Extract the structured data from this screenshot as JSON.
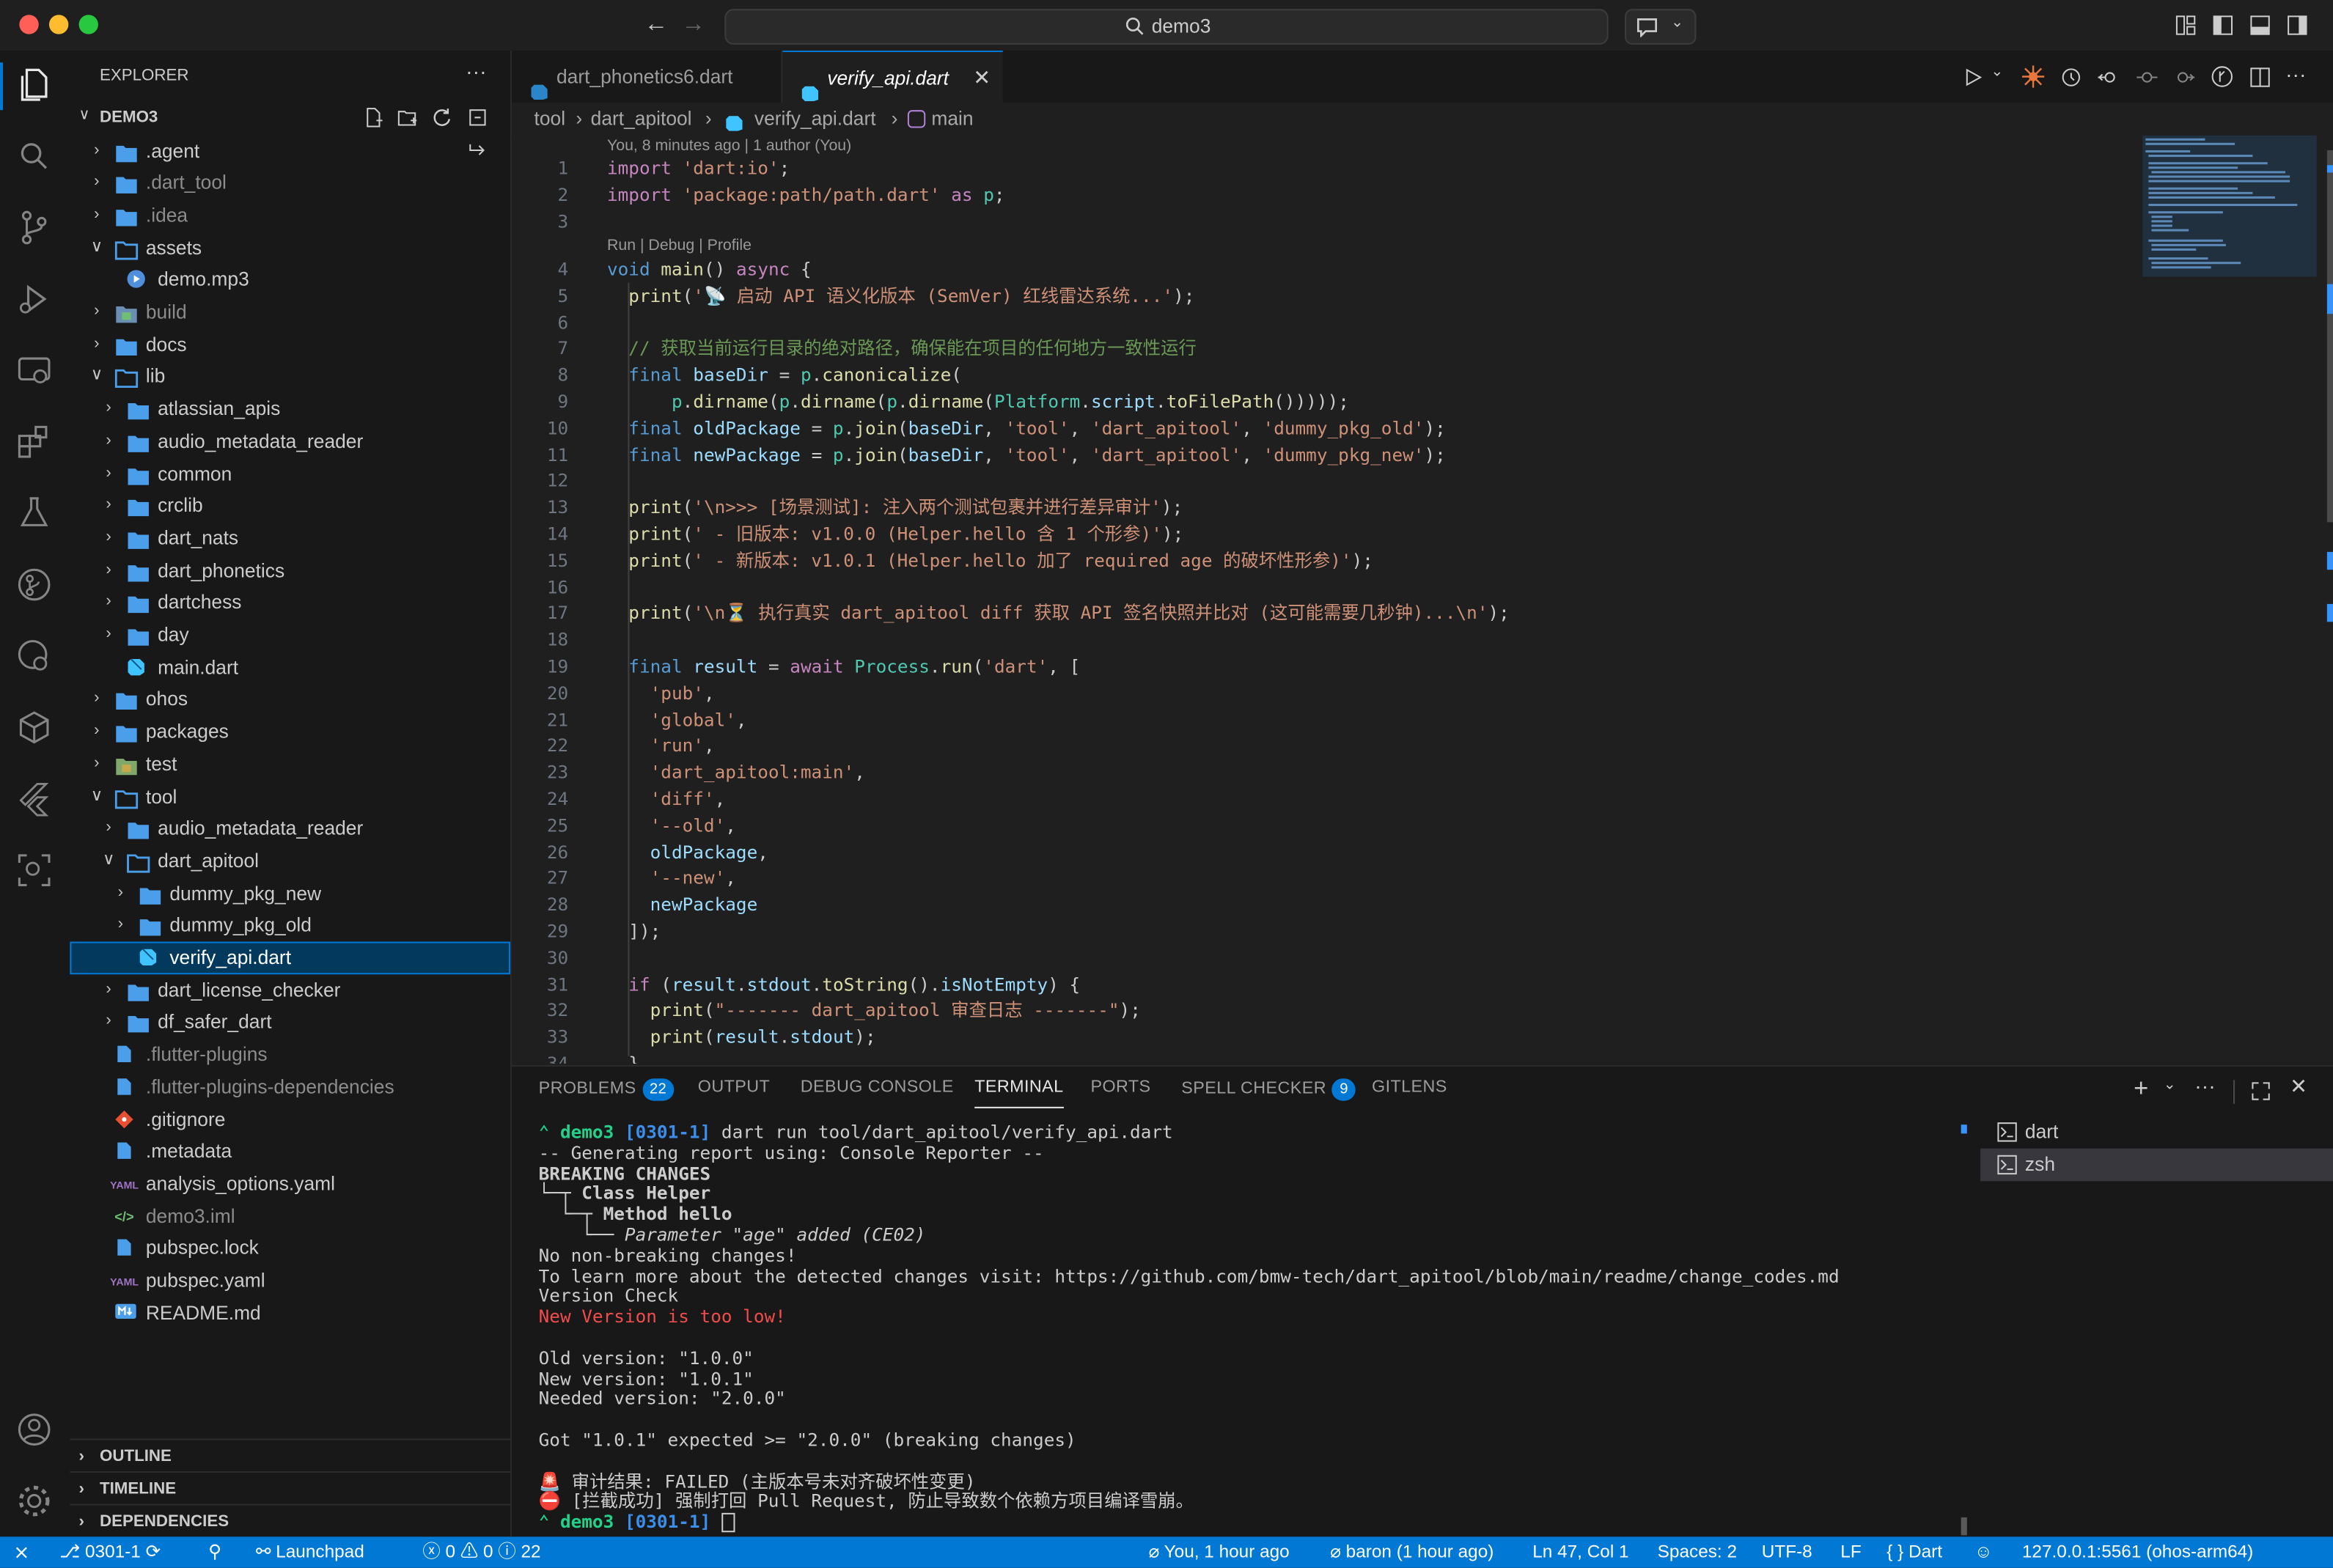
{
  "titlebar": {
    "search": "demo3"
  },
  "sidebar": {
    "title": "EXPLORER",
    "root": "DEMO3",
    "tree": [
      {
        "label": ".agent",
        "kind": "folder",
        "depth": 1,
        "open": false,
        "dim": false
      },
      {
        "label": ".dart_tool",
        "kind": "folder",
        "depth": 1,
        "open": false,
        "dim": true
      },
      {
        "label": ".idea",
        "kind": "folder",
        "depth": 1,
        "open": false,
        "dim": true
      },
      {
        "label": "assets",
        "kind": "folder",
        "depth": 1,
        "open": true,
        "dim": false
      },
      {
        "label": "demo.mp3",
        "kind": "file-media",
        "depth": 2,
        "dim": false
      },
      {
        "label": "build",
        "kind": "folder-build",
        "depth": 1,
        "open": false,
        "dim": true
      },
      {
        "label": "docs",
        "kind": "folder",
        "depth": 1,
        "open": false,
        "dim": false
      },
      {
        "label": "lib",
        "kind": "folder",
        "depth": 1,
        "open": true,
        "dim": false
      },
      {
        "label": "atlassian_apis",
        "kind": "folder",
        "depth": 2,
        "open": false,
        "dim": false
      },
      {
        "label": "audio_metadata_reader",
        "kind": "folder",
        "depth": 2,
        "open": false,
        "dim": false
      },
      {
        "label": "common",
        "kind": "folder",
        "depth": 2,
        "open": false,
        "dim": false
      },
      {
        "label": "crclib",
        "kind": "folder",
        "depth": 2,
        "open": false,
        "dim": false
      },
      {
        "label": "dart_nats",
        "kind": "folder",
        "depth": 2,
        "open": false,
        "dim": false
      },
      {
        "label": "dart_phonetics",
        "kind": "folder",
        "depth": 2,
        "open": false,
        "dim": false
      },
      {
        "label": "dartchess",
        "kind": "folder",
        "depth": 2,
        "open": false,
        "dim": false
      },
      {
        "label": "day",
        "kind": "folder",
        "depth": 2,
        "open": false,
        "dim": false
      },
      {
        "label": "main.dart",
        "kind": "file-dart",
        "depth": 2,
        "dim": false
      },
      {
        "label": "ohos",
        "kind": "folder",
        "depth": 1,
        "open": false,
        "dim": false
      },
      {
        "label": "packages",
        "kind": "folder",
        "depth": 1,
        "open": false,
        "dim": false
      },
      {
        "label": "test",
        "kind": "folder-test",
        "depth": 1,
        "open": false,
        "dim": false
      },
      {
        "label": "tool",
        "kind": "folder",
        "depth": 1,
        "open": true,
        "dim": false
      },
      {
        "label": "audio_metadata_reader",
        "kind": "folder",
        "depth": 2,
        "open": false,
        "dim": false
      },
      {
        "label": "dart_apitool",
        "kind": "folder",
        "depth": 2,
        "open": true,
        "dim": false
      },
      {
        "label": "dummy_pkg_new",
        "kind": "folder",
        "depth": 3,
        "open": false,
        "dim": false
      },
      {
        "label": "dummy_pkg_old",
        "kind": "folder",
        "depth": 3,
        "open": false,
        "dim": false
      },
      {
        "label": "verify_api.dart",
        "kind": "file-dart",
        "depth": 3,
        "dim": false,
        "selected": true
      },
      {
        "label": "dart_license_checker",
        "kind": "folder",
        "depth": 2,
        "open": false,
        "dim": false
      },
      {
        "label": "df_safer_dart",
        "kind": "folder",
        "depth": 2,
        "open": false,
        "dim": false
      },
      {
        "label": ".flutter-plugins",
        "kind": "file-generic",
        "depth": 1,
        "dim": true
      },
      {
        "label": ".flutter-plugins-dependencies",
        "kind": "file-generic",
        "depth": 1,
        "dim": true
      },
      {
        "label": ".gitignore",
        "kind": "file-git",
        "depth": 1,
        "dim": false
      },
      {
        "label": ".metadata",
        "kind": "file-generic",
        "depth": 1,
        "dim": false
      },
      {
        "label": "analysis_options.yaml",
        "kind": "file-yaml",
        "depth": 1,
        "dim": false
      },
      {
        "label": "demo3.iml",
        "kind": "file-xml",
        "depth": 1,
        "dim": true
      },
      {
        "label": "pubspec.lock",
        "kind": "file-generic",
        "depth": 1,
        "dim": false
      },
      {
        "label": "pubspec.yaml",
        "kind": "file-yaml",
        "depth": 1,
        "dim": false
      },
      {
        "label": "README.md",
        "kind": "file-md",
        "depth": 1,
        "dim": false
      }
    ],
    "sections": [
      "OUTLINE",
      "TIMELINE",
      "DEPENDENCIES"
    ]
  },
  "editor": {
    "tabs": [
      {
        "label": "dart_phonetics6.dart",
        "active": false
      },
      {
        "label": "verify_api.dart",
        "active": true
      }
    ],
    "breadcrumb": [
      "tool",
      "dart_apitool",
      "verify_api.dart",
      "main"
    ],
    "blame": "You, 8 minutes ago | 1 author (You)",
    "codelens": "Run | Debug | Profile",
    "lines": [
      "<span class=\"p\">import</span> <span class=\"s\">'dart:io'</span>;",
      "<span class=\"p\">import</span> <span class=\"s\">'package:path/path.dart'</span> <span class=\"p\">as</span> <span class=\"t\">p</span>;",
      "",
      "<span class=\"k\">void</span> <span class=\"f\">main</span>() <span class=\"p\">async</span> {",
      "  <span class=\"f\">print</span>(<span class=\"s\">'📡 启动 API 语义化版本 (SemVer) 红线雷达系统...'</span>);",
      "",
      "  <span class=\"c\">// 获取当前运行目录的绝对路径，确保能在项目的任何地方一致性运行</span>",
      "  <span class=\"k\">final</span> <span class=\"v\">baseDir</span> = <span class=\"t\">p</span>.<span class=\"f\">canonicalize</span>(",
      "      <span class=\"t\">p</span>.<span class=\"f\">dirname</span>(<span class=\"t\">p</span>.<span class=\"f\">dirname</span>(<span class=\"t\">p</span>.<span class=\"f\">dirname</span>(<span class=\"t\">Platform</span>.<span class=\"v\">script</span>.<span class=\"f\">toFilePath</span>())))); ",
      "  <span class=\"k\">final</span> <span class=\"v\">oldPackage</span> = <span class=\"t\">p</span>.<span class=\"f\">join</span>(<span class=\"v\">baseDir</span>, <span class=\"s\">'tool'</span>, <span class=\"s\">'dart_apitool'</span>, <span class=\"s\">'dummy_pkg_old'</span>);",
      "  <span class=\"k\">final</span> <span class=\"v\">newPackage</span> = <span class=\"t\">p</span>.<span class=\"f\">join</span>(<span class=\"v\">baseDir</span>, <span class=\"s\">'tool'</span>, <span class=\"s\">'dart_apitool'</span>, <span class=\"s\">'dummy_pkg_new'</span>);",
      "",
      "  <span class=\"f\">print</span>(<span class=\"s\">'\\n>>> [场景测试]: 注入两个测试包裹并进行差异审计'</span>);",
      "  <span class=\"f\">print</span>(<span class=\"s\">' - 旧版本: v1.0.0 (Helper.hello 含 1 个形参)'</span>);",
      "  <span class=\"f\">print</span>(<span class=\"s\">' - 新版本: v1.0.1 (Helper.hello 加了 required age 的破坏性形参)'</span>);",
      "",
      "  <span class=\"f\">print</span>(<span class=\"s\">'\\n⏳ 执行真实 dart_apitool diff 获取 API 签名快照并比对 (这可能需要几秒钟)...\\n'</span>);",
      "",
      "  <span class=\"k\">final</span> <span class=\"v\">result</span> = <span class=\"p\">await</span> <span class=\"t\">Process</span>.<span class=\"f\">run</span>(<span class=\"s\">'dart'</span>, [",
      "    <span class=\"s\">'pub'</span>,",
      "    <span class=\"s\">'global'</span>,",
      "    <span class=\"s\">'run'</span>,",
      "    <span class=\"s\">'dart_apitool:main'</span>,",
      "    <span class=\"s\">'diff'</span>,",
      "    <span class=\"s\">'--old'</span>,",
      "    <span class=\"v\">oldPackage</span>,",
      "    <span class=\"s\">'--new'</span>,",
      "    <span class=\"v\">newPackage</span>",
      "  ]);",
      "",
      "  <span class=\"p\">if</span> (<span class=\"v\">result</span>.<span class=\"v\">stdout</span>.<span class=\"f\">toString</span>().<span class=\"v\">isNotEmpty</span>) {",
      "    <span class=\"f\">print</span>(<span class=\"s\">\"------- dart_apitool 审查日志 -------\"</span>);",
      "    <span class=\"f\">print</span>(<span class=\"v\">result</span>.<span class=\"v\">stdout</span>);",
      "  }"
    ]
  },
  "panel": {
    "tabs": [
      {
        "label": "PROBLEMS",
        "badge": "22"
      },
      {
        "label": "OUTPUT"
      },
      {
        "label": "DEBUG CONSOLE"
      },
      {
        "label": "TERMINAL",
        "active": true
      },
      {
        "label": "PORTS"
      },
      {
        "label": "SPELL CHECKER",
        "badge": "9"
      },
      {
        "label": "GITLENS"
      }
    ],
    "terminal_lines": [
      {
        "text": "demo3 [0301-1] dart run tool/dart_apitool/verify_api.dart",
        "style": "prompt"
      },
      {
        "text": "-- Generating report using: Console Reporter --",
        "style": ""
      },
      {
        "text": "BREAKING CHANGES",
        "style": "bold"
      },
      {
        "text": "└─┬ Class Helper",
        "style": "bold"
      },
      {
        "text": "  └─┬ Method hello",
        "style": "bold"
      },
      {
        "text": "    └── Parameter \"age\" added (CE02)",
        "style": "ital"
      },
      {
        "text": "No non-breaking changes!",
        "style": ""
      },
      {
        "text": "To learn more about the detected changes visit: https://github.com/bmw-tech/dart_apitool/blob/main/readme/change_codes.md",
        "style": ""
      },
      {
        "text": "Version Check",
        "style": ""
      },
      {
        "text": "New Version is too low!",
        "style": "red"
      },
      {
        "text": "",
        "style": ""
      },
      {
        "text": "Old version: \"1.0.0\"",
        "style": ""
      },
      {
        "text": "New version: \"1.0.1\"",
        "style": ""
      },
      {
        "text": "Needed version: \"2.0.0\"",
        "style": ""
      },
      {
        "text": "",
        "style": ""
      },
      {
        "text": "Got \"1.0.1\" expected >= \"2.0.0\" (breaking changes)",
        "style": ""
      },
      {
        "text": "",
        "style": ""
      },
      {
        "text": "🚨 审计结果: FAILED (主版本号未对齐破坏性变更)",
        "style": ""
      },
      {
        "text": "⛔ [拦截成功] 强制打回 Pull Request, 防止导致数个依赖方项目编译雪崩。",
        "style": ""
      },
      {
        "text": "demo3 [0301-1] ",
        "style": "prompt2"
      }
    ],
    "terminals": [
      "dart",
      "zsh"
    ]
  },
  "statusbar": {
    "branch": "0301-1",
    "launch": "Launchpad",
    "errors": "0",
    "warnings": "0",
    "infos": "22",
    "blame": "You, 1 hour ago",
    "author": "baron (1 hour ago)",
    "position": "Ln 47, Col 1",
    "spaces": "Spaces: 2",
    "encoding": "UTF-8",
    "eol": "LF",
    "language": "Dart",
    "device": "127.0.0.1:5561 (ohos-arm64)"
  },
  "colors": {
    "accent": "#0078d4",
    "folder": "#4a9eea",
    "dart": "#40c4ff",
    "error_text": "#f14c4c"
  }
}
